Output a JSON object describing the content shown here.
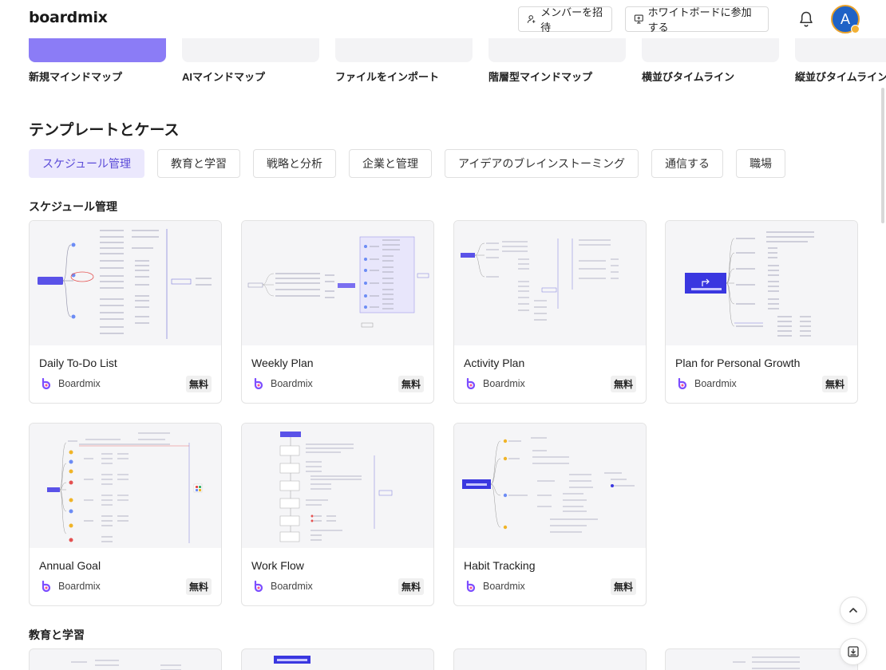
{
  "header": {
    "logo": "boardmix",
    "invite_label": "メンバーを招待",
    "join_label": "ホワイトボードに参加する",
    "avatar_letter": "A"
  },
  "quick_actions": [
    {
      "label": "新規マインドマップ"
    },
    {
      "label": "AIマインドマップ"
    },
    {
      "label": "ファイルをインポート"
    },
    {
      "label": "階層型マインドマップ"
    },
    {
      "label": "横並びタイムライン"
    },
    {
      "label": "縦並びタイムライン"
    }
  ],
  "section_title": "テンプレートとケース",
  "tabs": [
    {
      "label": "スケジュール管理",
      "active": true
    },
    {
      "label": "教育と学習"
    },
    {
      "label": "戦略と分析"
    },
    {
      "label": "企業と管理"
    },
    {
      "label": "アイデアのブレインストーミング"
    },
    {
      "label": "通信する"
    },
    {
      "label": "職場"
    }
  ],
  "schedule_section": {
    "title": "スケジュール管理",
    "cards": [
      {
        "title": "Daily To-Do List",
        "author": "Boardmix",
        "badge": "無料"
      },
      {
        "title": "Weekly Plan",
        "author": "Boardmix",
        "badge": "無料"
      },
      {
        "title": "Activity Plan",
        "author": "Boardmix",
        "badge": "無料"
      },
      {
        "title": "Plan for Personal Growth",
        "author": "Boardmix",
        "badge": "無料"
      },
      {
        "title": "Annual Goal",
        "author": "Boardmix",
        "badge": "無料"
      },
      {
        "title": "Work Flow",
        "author": "Boardmix",
        "badge": "無料"
      },
      {
        "title": "Habit Tracking",
        "author": "Boardmix",
        "badge": "無料"
      }
    ]
  },
  "education_section": {
    "title": "教育と学習"
  },
  "colors": {
    "accent": "#5b4bd8",
    "active_tab_bg": "#ebe8fd",
    "brand_purple": "#8b7cf6",
    "avatar": "#1e62c6"
  }
}
